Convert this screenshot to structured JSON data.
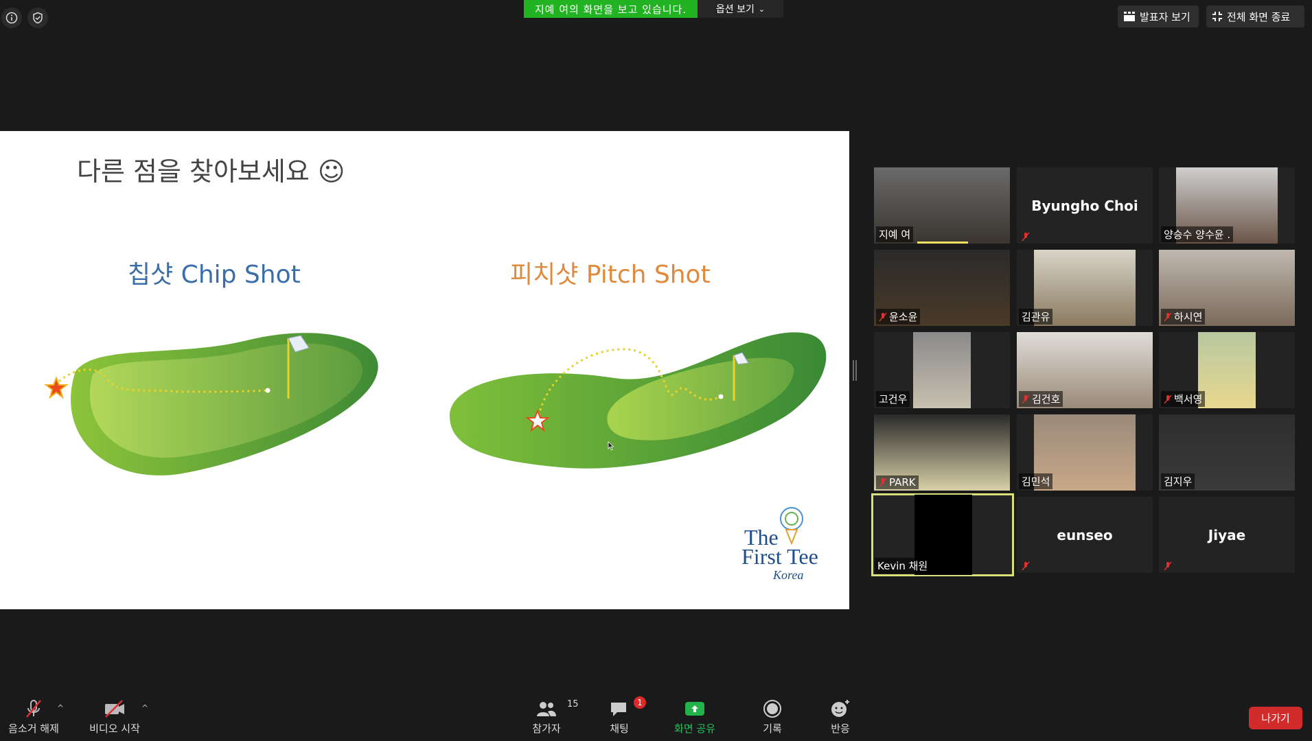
{
  "top": {
    "share_status": "지예 여의 화면을 보고 있습니다.",
    "view_options": "옵션 보기",
    "speaker_view": "발표자 보기",
    "exit_fullscreen": "전체 화면 종료"
  },
  "slide": {
    "title": "다른 점을 찾아보세요 ☺",
    "chip_label": "칩샷 Chip Shot",
    "pitch_label": "피치샷 Pitch Shot",
    "logo_line1": "The",
    "logo_line2": "First Tee",
    "logo_line3": "Korea"
  },
  "gallery": [
    {
      "name": "지예 여",
      "muted": false,
      "video": true,
      "speaking": true
    },
    {
      "name": "Byungho Choi",
      "muted": true,
      "video": false
    },
    {
      "name": "양승수 양수윤 .",
      "muted": false,
      "video": true
    },
    {
      "name": "윤소윤",
      "muted": true,
      "video": true
    },
    {
      "name": "김관유",
      "muted": false,
      "video": true
    },
    {
      "name": "하시연",
      "muted": true,
      "video": true
    },
    {
      "name": "고건우",
      "muted": false,
      "video": true
    },
    {
      "name": "김건호",
      "muted": true,
      "video": true
    },
    {
      "name": "백서영",
      "muted": true,
      "video": true
    },
    {
      "name": "PARK",
      "muted": true,
      "video": true
    },
    {
      "name": "김민석",
      "muted": false,
      "video": true
    },
    {
      "name": "김지우",
      "muted": false,
      "video": true
    },
    {
      "name": "Kevin 채원",
      "muted": false,
      "video": true,
      "active": true
    },
    {
      "name": "eunseo",
      "muted": true,
      "video": false
    },
    {
      "name": "Jiyae",
      "muted": true,
      "video": false
    }
  ],
  "bottom": {
    "unmute": "음소거 해제",
    "start_video": "비디오 시작",
    "participants": "참가자",
    "participants_count": "15",
    "chat": "채팅",
    "chat_badge": "1",
    "share_screen": "화면 공유",
    "record": "기록",
    "reactions": "반응",
    "leave": "나가기"
  },
  "colors": {
    "share_green": "#22b322",
    "leave_red": "#d12b2b",
    "active_border": "#d7e07a"
  }
}
